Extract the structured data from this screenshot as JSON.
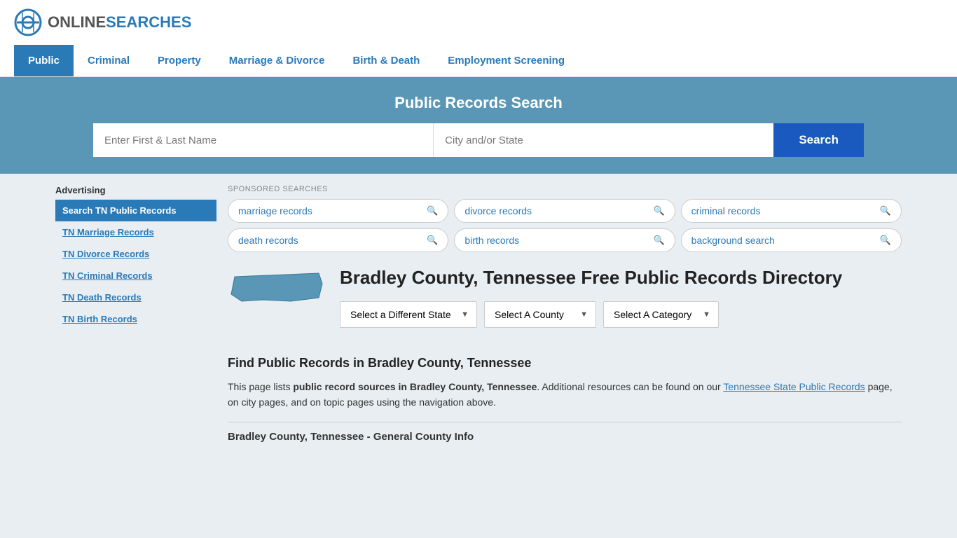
{
  "logo": {
    "online": "ONLINE",
    "searches": "SEARCHES"
  },
  "nav": {
    "items": [
      {
        "label": "Public",
        "active": true
      },
      {
        "label": "Criminal",
        "active": false
      },
      {
        "label": "Property",
        "active": false
      },
      {
        "label": "Marriage & Divorce",
        "active": false
      },
      {
        "label": "Birth & Death",
        "active": false
      },
      {
        "label": "Employment Screening",
        "active": false
      }
    ]
  },
  "search_banner": {
    "title": "Public Records Search",
    "name_placeholder": "Enter First & Last Name",
    "location_placeholder": "City and/or State",
    "button_label": "Search"
  },
  "sponsored": {
    "label": "SPONSORED SEARCHES",
    "pills": [
      "marriage records",
      "divorce records",
      "criminal records",
      "death records",
      "birth records",
      "background search"
    ]
  },
  "page": {
    "title": "Bradley County, Tennessee Free Public Records Directory",
    "state_label": "Tennessee",
    "dropdowns": {
      "state": "Select a Different State",
      "county": "Select A County",
      "category": "Select A Category"
    },
    "find_title": "Find Public Records in Bradley County, Tennessee",
    "description_part1": "This page lists ",
    "description_bold1": "public record sources in Bradley County, Tennessee",
    "description_part2": ". Additional resources can be found on our ",
    "description_link": "Tennessee State Public Records",
    "description_part3": " page, on city pages, and on topic pages using the navigation above.",
    "county_info_label": "Bradley County, Tennessee - General County Info"
  },
  "sidebar": {
    "ad_label": "Advertising",
    "ad_items": [
      {
        "label": "Search TN Public Records",
        "active": true
      },
      {
        "label": "TN Marriage Records",
        "active": false
      },
      {
        "label": "TN Divorce Records",
        "active": false
      },
      {
        "label": "TN Criminal Records",
        "active": false
      },
      {
        "label": "TN Death Records",
        "active": false
      },
      {
        "label": "TN Birth Records",
        "active": false
      }
    ]
  },
  "colors": {
    "primary_blue": "#2a7ab8",
    "dark_blue": "#1a5abf",
    "banner_bg": "#5a96b5",
    "active_nav": "#2a7ab8"
  }
}
